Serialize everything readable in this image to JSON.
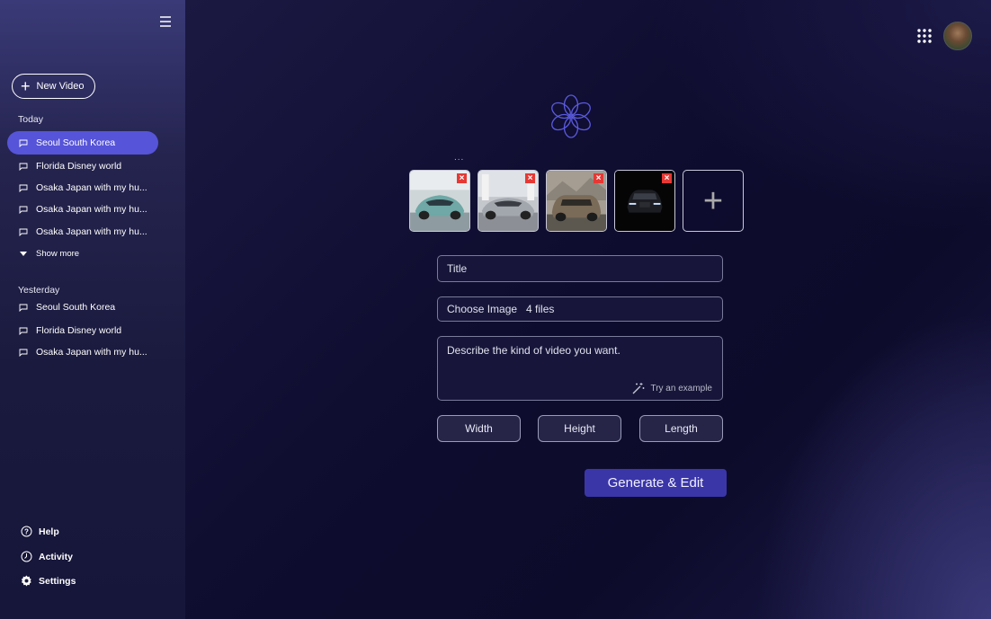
{
  "sidebar": {
    "new_video_label": "New Video",
    "today_title": "Today",
    "today_items": [
      {
        "label": "Seoul South Korea",
        "active": true
      },
      {
        "label": "Florida Disney world",
        "active": false
      },
      {
        "label": "Osaka Japan with my hu...",
        "active": false
      },
      {
        "label": "Osaka Japan with my hu...",
        "active": false
      },
      {
        "label": "Osaka Japan with my hu...",
        "active": false
      }
    ],
    "show_more_label": "Show more",
    "yesterday_title": "Yesterday",
    "yesterday_items": [
      {
        "label": "Seoul South Korea"
      },
      {
        "label": "Florida Disney world"
      },
      {
        "label": "Osaka Japan with my hu..."
      }
    ],
    "bottom_items": [
      {
        "label": "Help",
        "icon": "help-icon"
      },
      {
        "label": "Activity",
        "icon": "activity-icon"
      },
      {
        "label": "Settings",
        "icon": "gear-icon"
      }
    ]
  },
  "header": {
    "apps_icon": "grid-icon",
    "avatar": "user-avatar"
  },
  "main": {
    "dots": "...",
    "thumbnails": [
      {
        "name": "teal-supercar",
        "close": "×"
      },
      {
        "name": "silver-coupe",
        "close": "×"
      },
      {
        "name": "bronze-suv",
        "close": "×"
      },
      {
        "name": "black-suv-night",
        "close": "×"
      }
    ],
    "add_thumbnail": "+",
    "title_placeholder": "Title",
    "choose_image_label": "Choose Image",
    "choose_image_files": "4 files",
    "description_placeholder": "Describe the kind of video you want.",
    "try_example_label": "Try an example",
    "width_label": "Width",
    "height_label": "Height",
    "length_label": "Length",
    "generate_label": "Generate & Edit"
  },
  "colors": {
    "accent": "#5654d8",
    "generate": "#3a36a8",
    "close": "#e53935"
  }
}
